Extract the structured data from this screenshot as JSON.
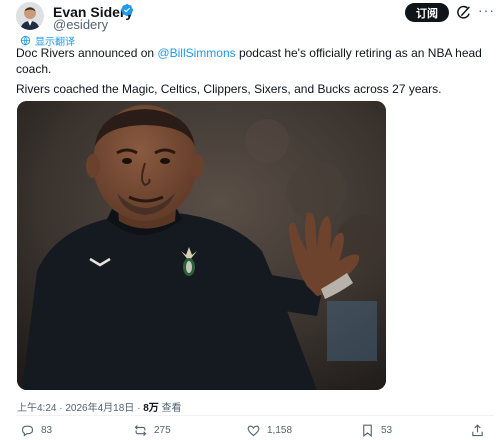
{
  "author": {
    "name": "Evan Sidery",
    "handle": "@esidery"
  },
  "header": {
    "subscribe_label": "订阅"
  },
  "post": {
    "translate_label": "显示翻译",
    "line1_before": "Doc Rivers announced on ",
    "mention": "@BillSimmons",
    "line1_after": " podcast he's officially retiring as an NBA head coach.",
    "line2": "Rivers coached the Magic, Celtics, Clippers, Sixers, and Bucks across 27 years."
  },
  "meta": {
    "time": "上午4:24",
    "separator": " · ",
    "date": "2026年4月18日",
    "views_count": "8万",
    "views_label": "查看"
  },
  "actions": {
    "replies": "83",
    "reposts": "275",
    "likes": "1,158",
    "bookmarks": "53"
  },
  "colors": {
    "accent": "#1d9bf0",
    "text": "#0f1419",
    "muted": "#536471"
  }
}
